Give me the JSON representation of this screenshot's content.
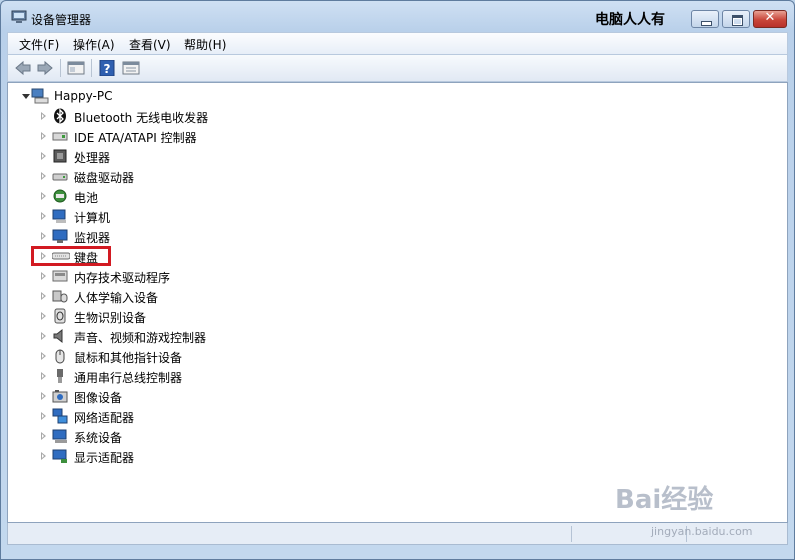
{
  "window": {
    "title": "设备管理器",
    "overlay_title": "电脑人人有",
    "close_label": "✕"
  },
  "menu": [
    {
      "label": "文件(F)"
    },
    {
      "label": "操作(A)"
    },
    {
      "label": "查看(V)"
    },
    {
      "label": "帮助(H)"
    }
  ],
  "tree": {
    "root": "Happy-PC",
    "items": [
      {
        "label": "Bluetooth 无线电收发器",
        "icon": "bluetooth-icon"
      },
      {
        "label": "IDE ATA/ATAPI 控制器",
        "icon": "ide-controller-icon"
      },
      {
        "label": "处理器",
        "icon": "processor-icon"
      },
      {
        "label": "磁盘驱动器",
        "icon": "disk-drive-icon"
      },
      {
        "label": "电池",
        "icon": "battery-icon"
      },
      {
        "label": "计算机",
        "icon": "computer-icon"
      },
      {
        "label": "监视器",
        "icon": "monitor-icon"
      },
      {
        "label": "键盘",
        "icon": "keyboard-icon"
      },
      {
        "label": "内存技术驱动程序",
        "icon": "memory-icon"
      },
      {
        "label": "人体学输入设备",
        "icon": "hid-icon"
      },
      {
        "label": "生物识别设备",
        "icon": "biometric-icon"
      },
      {
        "label": "声音、视频和游戏控制器",
        "icon": "sound-icon"
      },
      {
        "label": "鼠标和其他指针设备",
        "icon": "mouse-icon"
      },
      {
        "label": "通用串行总线控制器",
        "icon": "usb-icon"
      },
      {
        "label": "图像设备",
        "icon": "camera-icon"
      },
      {
        "label": "网络适配器",
        "icon": "network-icon"
      },
      {
        "label": "系统设备",
        "icon": "system-device-icon"
      },
      {
        "label": "显示适配器",
        "icon": "display-adapter-icon"
      }
    ]
  },
  "watermark": {
    "logo": "Bai经验",
    "url": "jingyan.baidu.com"
  },
  "colors": {
    "highlight": "#d21a22",
    "accent": "#5f7c9e"
  }
}
